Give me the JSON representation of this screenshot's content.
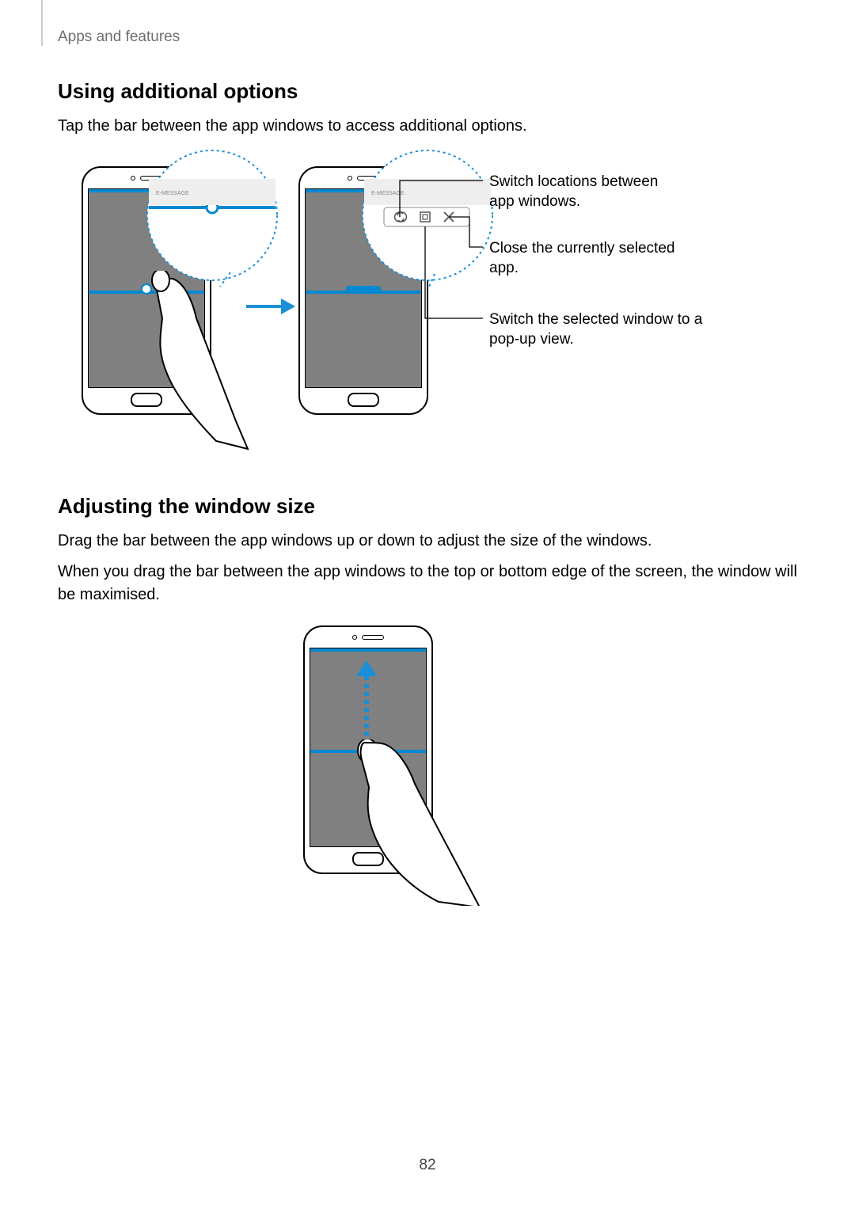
{
  "header": {
    "running": "Apps and features"
  },
  "section1": {
    "title": "Using additional options",
    "body": "Tap the bar between the app windows to access additional options."
  },
  "callouts": {
    "switch_locations": "Switch locations between app windows.",
    "close_app": "Close the currently selected app.",
    "popup_view": "Switch the selected window to a pop-up view."
  },
  "section2": {
    "title": "Adjusting the window size",
    "body1": "Drag the bar between the app windows up or down to adjust the size of the windows.",
    "body2": "When you drag the bar between the app windows to the top or bottom edge of the screen, the window will be maximised."
  },
  "page_number": "82"
}
